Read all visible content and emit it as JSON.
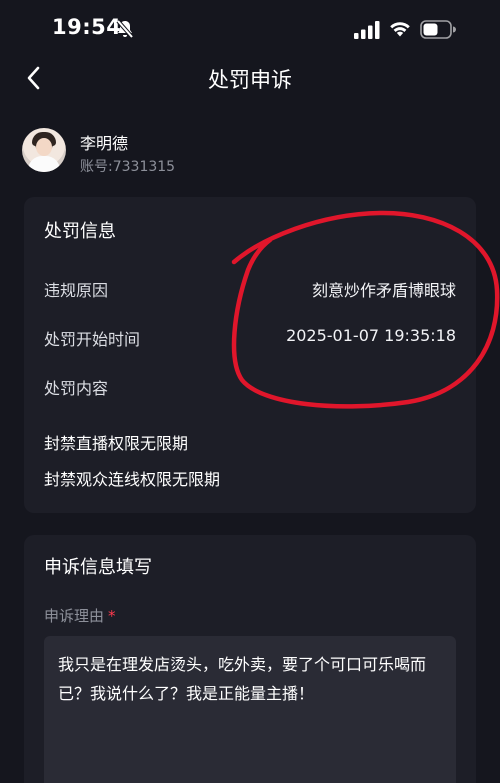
{
  "status_bar": {
    "time": "19:54"
  },
  "nav": {
    "title": "处罚申诉"
  },
  "user": {
    "name": "李明德",
    "account": "账号:7331315"
  },
  "penalty_info": {
    "title": "处罚信息",
    "rows": [
      {
        "label": "违规原因",
        "value": "刻意炒作矛盾博眼球"
      },
      {
        "label": "处罚开始时间",
        "value": "2025-01-07 19:35:18"
      }
    ],
    "content_label": "处罚内容",
    "content_items": [
      "封禁直播权限无限期",
      "封禁观众连线权限无限期"
    ]
  },
  "appeal": {
    "title": "申诉信息填写",
    "reason_label": "申诉理由",
    "required_mark": "*",
    "reason_text": "我只是在理发店烫头，吃外卖，要了个可口可乐喝而已？我说什么了？我是正能量主播！"
  },
  "icons": [
    "mute-icon",
    "signal-icon",
    "wifi-icon",
    "battery-icon",
    "back-chevron-icon"
  ],
  "colors": {
    "background": "#15161e",
    "card": "#1d1e27",
    "required": "#ff3b4e",
    "annotation": "#e0162b"
  }
}
